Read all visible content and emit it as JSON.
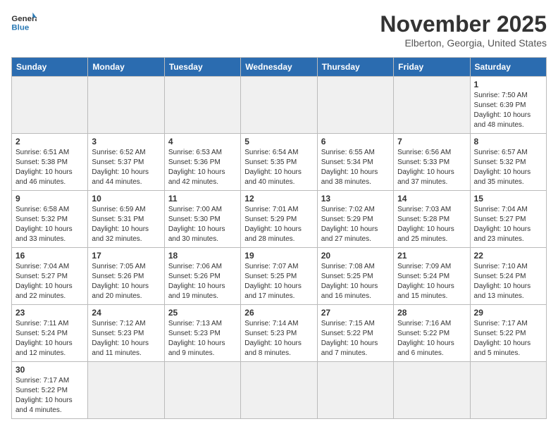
{
  "header": {
    "logo_general": "General",
    "logo_blue": "Blue",
    "month_title": "November 2025",
    "location": "Elberton, Georgia, United States"
  },
  "weekdays": [
    "Sunday",
    "Monday",
    "Tuesday",
    "Wednesday",
    "Thursday",
    "Friday",
    "Saturday"
  ],
  "weeks": [
    [
      {
        "day": "",
        "info": ""
      },
      {
        "day": "",
        "info": ""
      },
      {
        "day": "",
        "info": ""
      },
      {
        "day": "",
        "info": ""
      },
      {
        "day": "",
        "info": ""
      },
      {
        "day": "",
        "info": ""
      },
      {
        "day": "1",
        "info": "Sunrise: 7:50 AM\nSunset: 6:39 PM\nDaylight: 10 hours and 48 minutes."
      }
    ],
    [
      {
        "day": "2",
        "info": "Sunrise: 6:51 AM\nSunset: 5:38 PM\nDaylight: 10 hours and 46 minutes."
      },
      {
        "day": "3",
        "info": "Sunrise: 6:52 AM\nSunset: 5:37 PM\nDaylight: 10 hours and 44 minutes."
      },
      {
        "day": "4",
        "info": "Sunrise: 6:53 AM\nSunset: 5:36 PM\nDaylight: 10 hours and 42 minutes."
      },
      {
        "day": "5",
        "info": "Sunrise: 6:54 AM\nSunset: 5:35 PM\nDaylight: 10 hours and 40 minutes."
      },
      {
        "day": "6",
        "info": "Sunrise: 6:55 AM\nSunset: 5:34 PM\nDaylight: 10 hours and 38 minutes."
      },
      {
        "day": "7",
        "info": "Sunrise: 6:56 AM\nSunset: 5:33 PM\nDaylight: 10 hours and 37 minutes."
      },
      {
        "day": "8",
        "info": "Sunrise: 6:57 AM\nSunset: 5:32 PM\nDaylight: 10 hours and 35 minutes."
      }
    ],
    [
      {
        "day": "9",
        "info": "Sunrise: 6:58 AM\nSunset: 5:32 PM\nDaylight: 10 hours and 33 minutes."
      },
      {
        "day": "10",
        "info": "Sunrise: 6:59 AM\nSunset: 5:31 PM\nDaylight: 10 hours and 32 minutes."
      },
      {
        "day": "11",
        "info": "Sunrise: 7:00 AM\nSunset: 5:30 PM\nDaylight: 10 hours and 30 minutes."
      },
      {
        "day": "12",
        "info": "Sunrise: 7:01 AM\nSunset: 5:29 PM\nDaylight: 10 hours and 28 minutes."
      },
      {
        "day": "13",
        "info": "Sunrise: 7:02 AM\nSunset: 5:29 PM\nDaylight: 10 hours and 27 minutes."
      },
      {
        "day": "14",
        "info": "Sunrise: 7:03 AM\nSunset: 5:28 PM\nDaylight: 10 hours and 25 minutes."
      },
      {
        "day": "15",
        "info": "Sunrise: 7:04 AM\nSunset: 5:27 PM\nDaylight: 10 hours and 23 minutes."
      }
    ],
    [
      {
        "day": "16",
        "info": "Sunrise: 7:04 AM\nSunset: 5:27 PM\nDaylight: 10 hours and 22 minutes."
      },
      {
        "day": "17",
        "info": "Sunrise: 7:05 AM\nSunset: 5:26 PM\nDaylight: 10 hours and 20 minutes."
      },
      {
        "day": "18",
        "info": "Sunrise: 7:06 AM\nSunset: 5:26 PM\nDaylight: 10 hours and 19 minutes."
      },
      {
        "day": "19",
        "info": "Sunrise: 7:07 AM\nSunset: 5:25 PM\nDaylight: 10 hours and 17 minutes."
      },
      {
        "day": "20",
        "info": "Sunrise: 7:08 AM\nSunset: 5:25 PM\nDaylight: 10 hours and 16 minutes."
      },
      {
        "day": "21",
        "info": "Sunrise: 7:09 AM\nSunset: 5:24 PM\nDaylight: 10 hours and 15 minutes."
      },
      {
        "day": "22",
        "info": "Sunrise: 7:10 AM\nSunset: 5:24 PM\nDaylight: 10 hours and 13 minutes."
      }
    ],
    [
      {
        "day": "23",
        "info": "Sunrise: 7:11 AM\nSunset: 5:24 PM\nDaylight: 10 hours and 12 minutes."
      },
      {
        "day": "24",
        "info": "Sunrise: 7:12 AM\nSunset: 5:23 PM\nDaylight: 10 hours and 11 minutes."
      },
      {
        "day": "25",
        "info": "Sunrise: 7:13 AM\nSunset: 5:23 PM\nDaylight: 10 hours and 9 minutes."
      },
      {
        "day": "26",
        "info": "Sunrise: 7:14 AM\nSunset: 5:23 PM\nDaylight: 10 hours and 8 minutes."
      },
      {
        "day": "27",
        "info": "Sunrise: 7:15 AM\nSunset: 5:22 PM\nDaylight: 10 hours and 7 minutes."
      },
      {
        "day": "28",
        "info": "Sunrise: 7:16 AM\nSunset: 5:22 PM\nDaylight: 10 hours and 6 minutes."
      },
      {
        "day": "29",
        "info": "Sunrise: 7:17 AM\nSunset: 5:22 PM\nDaylight: 10 hours and 5 minutes."
      }
    ],
    [
      {
        "day": "30",
        "info": "Sunrise: 7:17 AM\nSunset: 5:22 PM\nDaylight: 10 hours and 4 minutes."
      },
      {
        "day": "",
        "info": ""
      },
      {
        "day": "",
        "info": ""
      },
      {
        "day": "",
        "info": ""
      },
      {
        "day": "",
        "info": ""
      },
      {
        "day": "",
        "info": ""
      },
      {
        "day": "",
        "info": ""
      }
    ]
  ]
}
